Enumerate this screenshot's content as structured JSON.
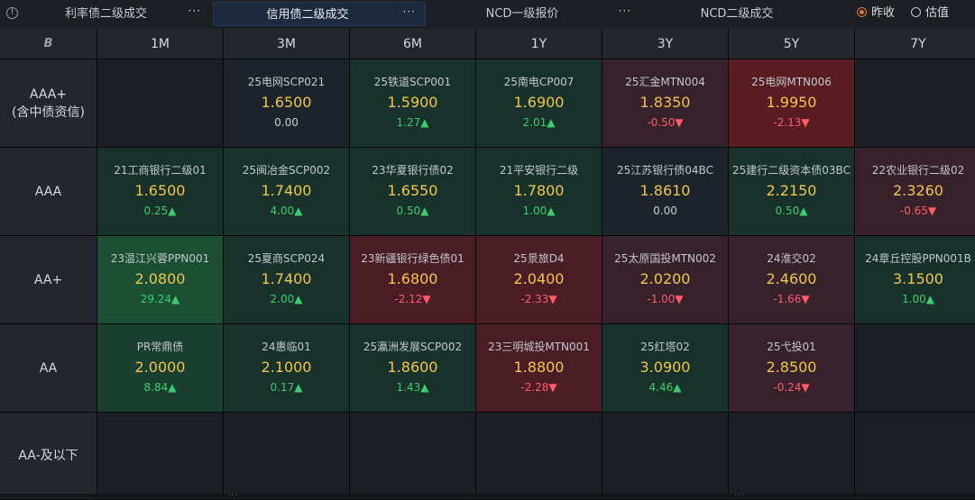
{
  "tabs": [
    {
      "label": "利率债二级成交",
      "active": false
    },
    {
      "label": "信用债二级成交",
      "active": true
    },
    {
      "label": "NCD一级报价",
      "active": false
    },
    {
      "label": "NCD二级成交",
      "active": false
    }
  ],
  "tab_more": "···",
  "radio": {
    "option1": "昨收",
    "option2": "估值",
    "selected": "昨收"
  },
  "corner_icon": "B",
  "columns": [
    "1M",
    "3M",
    "6M",
    "1Y",
    "3Y",
    "5Y",
    "7Y"
  ],
  "rows": [
    {
      "label": "AAA+",
      "sublabel": "(含中债资信)",
      "cells": [
        null,
        {
          "bond": "25电网SCP021",
          "yield": "1.6500",
          "chg": "0.00",
          "dir": "flat",
          "tone": "neutral"
        },
        {
          "bond": "25铁道SCP001",
          "yield": "1.5900",
          "chg": "1.27▲",
          "dir": "up",
          "tone": "green1"
        },
        {
          "bond": "25南电CP007",
          "yield": "1.6900",
          "chg": "2.01▲",
          "dir": "up",
          "tone": "green1"
        },
        {
          "bond": "25汇金MTN004",
          "yield": "1.8350",
          "chg": "-0.50▼",
          "dir": "down",
          "tone": "red1"
        },
        {
          "bond": "25电网MTN006",
          "yield": "1.9950",
          "chg": "-2.13▼",
          "dir": "down",
          "tone": "red3"
        },
        null
      ]
    },
    {
      "label": "AAA",
      "sublabel": "",
      "cells": [
        {
          "bond": "21工商银行二级01",
          "yield": "1.6500",
          "chg": "0.25▲",
          "dir": "up",
          "tone": "green1"
        },
        {
          "bond": "25闽冶金SCP002",
          "yield": "1.7400",
          "chg": "4.00▲",
          "dir": "up",
          "tone": "green1"
        },
        {
          "bond": "23华夏银行债02",
          "yield": "1.6550",
          "chg": "0.50▲",
          "dir": "up",
          "tone": "green1"
        },
        {
          "bond": "21平安银行二级",
          "yield": "1.7800",
          "chg": "1.00▲",
          "dir": "up",
          "tone": "green1"
        },
        {
          "bond": "25江苏银行债04BC",
          "yield": "1.8610",
          "chg": "0.00",
          "dir": "flat",
          "tone": "neutral"
        },
        {
          "bond": "25建行二级资本债03BC",
          "yield": "2.2150",
          "chg": "0.50▲",
          "dir": "up",
          "tone": "green1"
        },
        {
          "bond": "22农业银行二级02",
          "yield": "2.3260",
          "chg": "-0.65▼",
          "dir": "down",
          "tone": "red1"
        }
      ]
    },
    {
      "label": "AA+",
      "sublabel": "",
      "cells": [
        {
          "bond": "23温江兴蓉PPN001",
          "yield": "2.0800",
          "chg": "29.24▲",
          "dir": "up",
          "tone": "green3"
        },
        {
          "bond": "25夏商SCP024",
          "yield": "1.7400",
          "chg": "2.00▲",
          "dir": "up",
          "tone": "green1"
        },
        {
          "bond": "23新疆银行绿色债01",
          "yield": "1.6800",
          "chg": "-2.12▼",
          "dir": "down",
          "tone": "red2"
        },
        {
          "bond": "25景旅D4",
          "yield": "2.0400",
          "chg": "-2.33▼",
          "dir": "down",
          "tone": "red2"
        },
        {
          "bond": "25太原国投MTN002",
          "yield": "2.0200",
          "chg": "-1.00▼",
          "dir": "down",
          "tone": "red1"
        },
        {
          "bond": "24淮交02",
          "yield": "2.4600",
          "chg": "-1.66▼",
          "dir": "down",
          "tone": "red1"
        },
        {
          "bond": "24章丘控股PPN001B",
          "yield": "3.1500",
          "chg": "1.00▲",
          "dir": "up",
          "tone": "green1"
        }
      ]
    },
    {
      "label": "AA",
      "sublabel": "",
      "cells": [
        {
          "bond": "PR常鼎债",
          "yield": "2.0000",
          "chg": "8.84▲",
          "dir": "up",
          "tone": "green2"
        },
        {
          "bond": "24惠临01",
          "yield": "2.1000",
          "chg": "0.17▲",
          "dir": "up",
          "tone": "green1"
        },
        {
          "bond": "25瀛洲发展SCP002",
          "yield": "1.8600",
          "chg": "1.43▲",
          "dir": "up",
          "tone": "green1"
        },
        {
          "bond": "23三明城投MTN001",
          "yield": "1.8800",
          "chg": "-2.28▼",
          "dir": "down",
          "tone": "red2"
        },
        {
          "bond": "25红塔02",
          "yield": "3.0900",
          "chg": "4.46▲",
          "dir": "up",
          "tone": "green1"
        },
        {
          "bond": "25弋投01",
          "yield": "2.8500",
          "chg": "-0.24▼",
          "dir": "down",
          "tone": "red1"
        },
        null
      ]
    },
    {
      "label": "AA-及以下",
      "sublabel": "",
      "cells": [
        null,
        null,
        null,
        null,
        null,
        null,
        null
      ]
    }
  ]
}
